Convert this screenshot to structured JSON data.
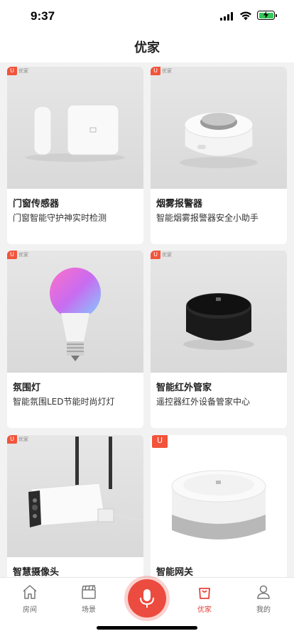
{
  "status_bar": {
    "time": "9:37"
  },
  "nav": {
    "title": "优家"
  },
  "products": [
    {
      "title": "门窗传感器",
      "subtitle": "门窗智能守护神实时检测",
      "brand_tag": "优家"
    },
    {
      "title": "烟雾报警器",
      "subtitle": "智能烟雾报警器安全小助手",
      "brand_tag": "优家"
    },
    {
      "title": "氛围灯",
      "subtitle": "智能氛围LED节能时尚灯灯",
      "brand_tag": "优家"
    },
    {
      "title": "智能红外管家",
      "subtitle": "遥控器红外设备管家中心",
      "brand_tag": "优家"
    },
    {
      "title": "智慧摄像头",
      "subtitle": "",
      "brand_tag": "优家"
    },
    {
      "title": "智能网关",
      "subtitle": "",
      "brand_tag": ""
    }
  ],
  "tab_bar": {
    "tabs": [
      {
        "label": "房间",
        "icon": "house-icon"
      },
      {
        "label": "场景",
        "icon": "clapperboard-icon"
      },
      {
        "label": "优家",
        "icon": "shopping-bag-icon",
        "active": true
      },
      {
        "label": "我的",
        "icon": "person-icon"
      }
    ],
    "center_icon": "microphone-icon"
  },
  "colors": {
    "accent": "#e8423a",
    "battery": "#34c759"
  }
}
